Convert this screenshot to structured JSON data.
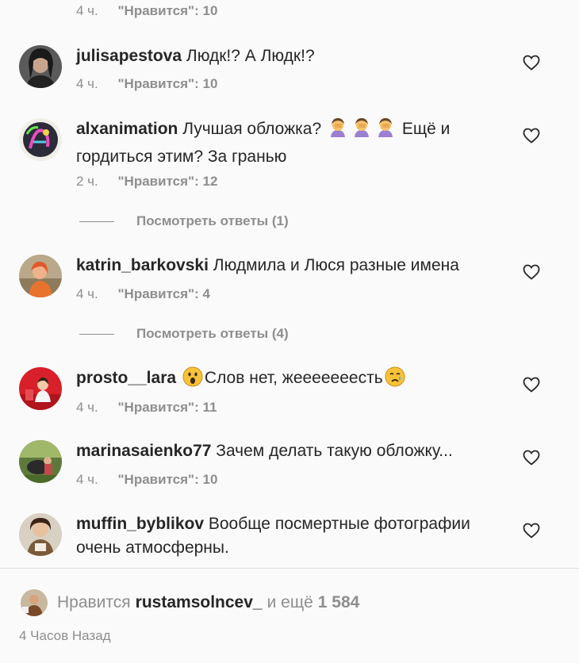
{
  "top_meta": {
    "time": "4 ч.",
    "likes": "\"Нравится\": 10"
  },
  "comments": [
    {
      "user": "julisapestova",
      "text": "Людк!? А Людк!?",
      "time": "4 ч.",
      "likes": "\"Нравится\": 10"
    },
    {
      "user": "alxanimation",
      "text_a": "Лучшая обложка?",
      "text_b": "Ещё и гордиться этим? За гранью",
      "time": "2 ч.",
      "likes": "\"Нравится\": 12",
      "replies": "Посмотреть ответы (1)"
    },
    {
      "user": "katrin_barkovski",
      "text": "Людмила и Люся разные имена",
      "time": "4 ч.",
      "likes": "\"Нравится\": 4",
      "replies": "Посмотреть ответы (4)"
    },
    {
      "user": "prosto__lara",
      "text": "Слов нет, жееееееесть",
      "time": "4 ч.",
      "likes": "\"Нравится\": 11"
    },
    {
      "user": "marinasaienko77",
      "text": "Зачем делать такую обложку...",
      "time": "4 ч.",
      "likes": "\"Нравится\": 10"
    },
    {
      "user": "muffin_byblikov",
      "text": "Вообще посмертные фотографии очень атмосферны."
    }
  ],
  "likes_summary": {
    "prefix": "Нравится",
    "user": "rustamsolncev_",
    "middle": "и ещё",
    "count": "1 584"
  },
  "time_ago": "4 Часов Назад",
  "colors": {
    "text": "#262626",
    "secondary": "#8e8e8e",
    "background": "#fafafa",
    "divider": "#dbdbdb"
  }
}
